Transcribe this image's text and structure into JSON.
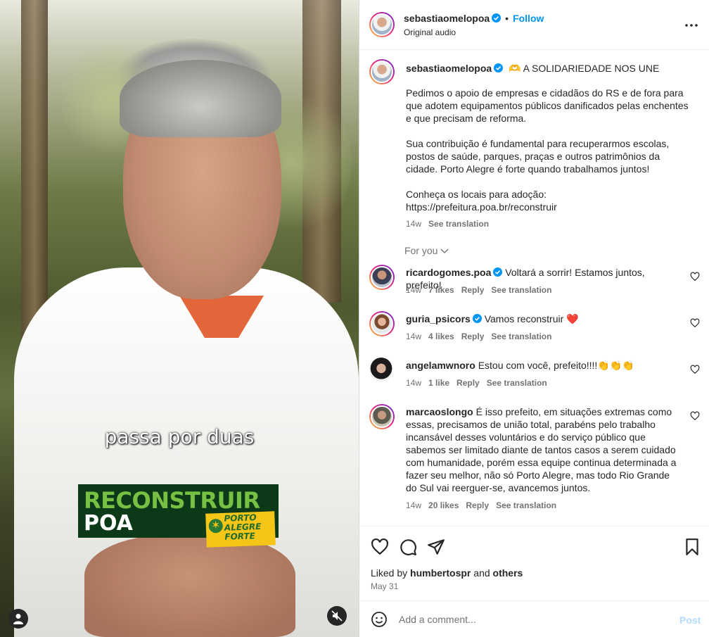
{
  "video": {
    "subtitle": "passa por duas",
    "banner_line1": "RECONSTRUIR",
    "banner_line2": "POA",
    "badge_text": "PORTO\nALEGRE\nFORTE"
  },
  "header": {
    "username": "sebastiaomelopoa",
    "follow_label": "Follow",
    "separator": "•",
    "audio": "Original audio"
  },
  "caption": {
    "username": "sebastiaomelopoa",
    "headline": "🫶 A SOLIDARIEDADE NOS UNE",
    "body": "Pedimos o apoio de empresas e cidadãos do RS e de fora para que adotem equipamentos públicos danificados pelas enchentes e que precisam de reforma.\n\nSua contribuição é fundamental para recuperarmos escolas, postos de saúde, parques, praças e outros patrimônios da cidade. Porto Alegre é forte quando trabalhamos juntos!\n\nConheça os locais para adoção:\nhttps://prefeitura.poa.br/reconstruir",
    "time": "14w",
    "see_translation": "See translation"
  },
  "for_you": "For you",
  "comments": [
    {
      "username": "ricardogomes.poa",
      "verified": true,
      "text": "Voltará a sorrir! Estamos juntos, prefeito!",
      "time": "14w",
      "likes": "7 likes",
      "reply": "Reply",
      "see_translation": "See translation"
    },
    {
      "username": "guria_psicors",
      "verified": true,
      "text": "Vamos reconstruir ❤️",
      "time": "14w",
      "likes": "4 likes",
      "reply": "Reply",
      "see_translation": "See translation"
    },
    {
      "username": "angelamwnoro",
      "verified": false,
      "text": "Estou com você, prefeito!!!!👏👏👏",
      "time": "14w",
      "likes": "1 like",
      "reply": "Reply",
      "see_translation": "See translation"
    },
    {
      "username": "marcaoslongo",
      "verified": false,
      "text": "É isso prefeito, em situações extremas como essas, precisamos de união total, parabéns pelo trabalho incansável desses voluntários e do serviço público que sabemos ser limitado diante de tantos casos a serem cuidado com humanidade, porém essa equipe continua determinada a fazer seu melhor, não só Porto Alegre, mas todo Rio Grande do Sul vai reerguer-se, avancemos juntos.",
      "time": "14w",
      "likes": "20 likes",
      "reply": "Reply",
      "see_translation": "See translation"
    }
  ],
  "actions": {
    "liked_prefix": "Liked by",
    "liked_user": "humbertospr",
    "liked_and": "and",
    "liked_others": "others",
    "date": "May 31"
  },
  "add_comment": {
    "placeholder": "Add a comment...",
    "post_label": "Post"
  },
  "colors": {
    "accent": "#0095f6",
    "muted_text": "#737373",
    "post_disabled": "#b3dbff",
    "banner_bg": "#0c3a18",
    "banner_green": "#76c043"
  }
}
